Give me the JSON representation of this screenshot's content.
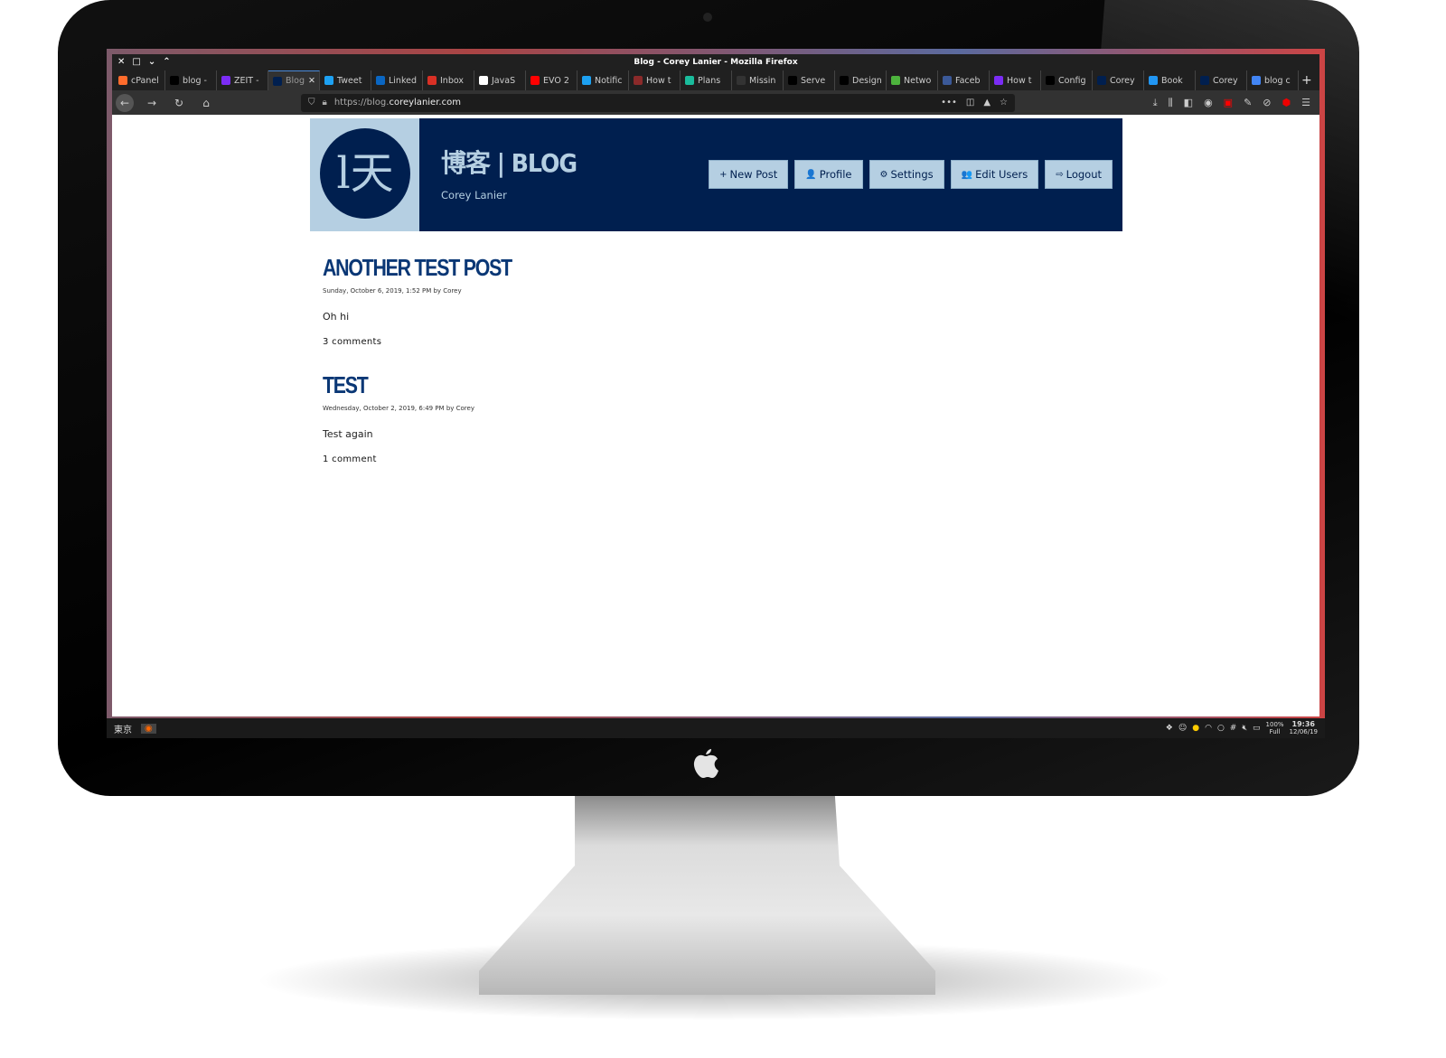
{
  "window_title": "Blog - Corey Lanier - Mozilla Firefox",
  "tabs": [
    {
      "label": "cPanel",
      "icon": "cpanel-icon",
      "color": "#ff6c2c"
    },
    {
      "label": "blog -",
      "icon": "triangle-icon",
      "color": "#000000"
    },
    {
      "label": "ZEIT -",
      "icon": "zeit-icon",
      "color": "#7b2cf5"
    },
    {
      "label": "Blog",
      "icon": "blog-logo-icon",
      "color": "#001f4f",
      "active": true
    },
    {
      "label": "Tweet",
      "icon": "twitter-icon",
      "color": "#1da1f2"
    },
    {
      "label": "Linked",
      "icon": "linkedin-icon",
      "color": "#0a66c2"
    },
    {
      "label": "Inbox",
      "icon": "gmail-icon",
      "color": "#d93025"
    },
    {
      "label": "JavaS",
      "icon": "wikipedia-icon",
      "color": "#ffffff"
    },
    {
      "label": "EVO 2",
      "icon": "youtube-icon",
      "color": "#ff0000"
    },
    {
      "label": "Notific",
      "icon": "twitter-icon",
      "color": "#1da1f2"
    },
    {
      "label": "How t",
      "icon": "diamond-icon",
      "color": "#8b2a2a"
    },
    {
      "label": "Plans",
      "icon": "diamond-icon",
      "color": "#1abc9c"
    },
    {
      "label": "Missin",
      "icon": "github-icon",
      "color": "#333333"
    },
    {
      "label": "Serve",
      "icon": "triangle-icon",
      "color": "#000000"
    },
    {
      "label": "Design",
      "icon": "medium-icon",
      "color": "#000000"
    },
    {
      "label": "Netwo",
      "icon": "mongodb-icon",
      "color": "#4db33d"
    },
    {
      "label": "Faceb",
      "icon": "facebook-icon",
      "color": "#3b5998"
    },
    {
      "label": "How t",
      "icon": "zeit-icon",
      "color": "#7b2cf5"
    },
    {
      "label": "Config",
      "icon": "triangle-icon",
      "color": "#000000"
    },
    {
      "label": "Corey",
      "icon": "blog-logo-icon",
      "color": "#001f4f"
    },
    {
      "label": "Book",
      "icon": "flag-icon",
      "color": "#2196f3"
    },
    {
      "label": "Corey",
      "icon": "blog-logo-icon",
      "color": "#001f4f"
    },
    {
      "label": "blog c",
      "icon": "google-icon",
      "color": "#4285f4"
    }
  ],
  "url": {
    "scheme": "https://blog.",
    "host": "coreylanier.com"
  },
  "site": {
    "logo_text": "l天",
    "title": "博客 | BLOG",
    "subtitle": "Corey Lanier"
  },
  "nav": [
    {
      "label": "New Post",
      "icon": "plus-icon",
      "glyph": "+"
    },
    {
      "label": "Profile",
      "icon": "user-icon",
      "glyph": "👤"
    },
    {
      "label": "Settings",
      "icon": "gear-icon",
      "glyph": "⚙"
    },
    {
      "label": "Edit Users",
      "icon": "users-icon",
      "glyph": "👥"
    },
    {
      "label": "Logout",
      "icon": "logout-icon",
      "glyph": "⇨"
    }
  ],
  "posts": [
    {
      "title": "ANOTHER TEST POST",
      "meta": "Sunday, October 6, 2019, 1:52 PM by Corey",
      "body": "Oh hi",
      "comments": "3 comments"
    },
    {
      "title": "TEST",
      "meta": "Wednesday, October 2, 2019, 6:49 PM by Corey",
      "body": "Test again",
      "comments": "1 comment"
    }
  ],
  "taskbar": {
    "workspace": "東京",
    "battery": "100%",
    "battery_status": "Full",
    "time": "19:36",
    "date": "12/06/19"
  },
  "colors": {
    "header_bg": "#001f4f",
    "accent": "#b5cfe2",
    "post_title": "#0a3775"
  }
}
